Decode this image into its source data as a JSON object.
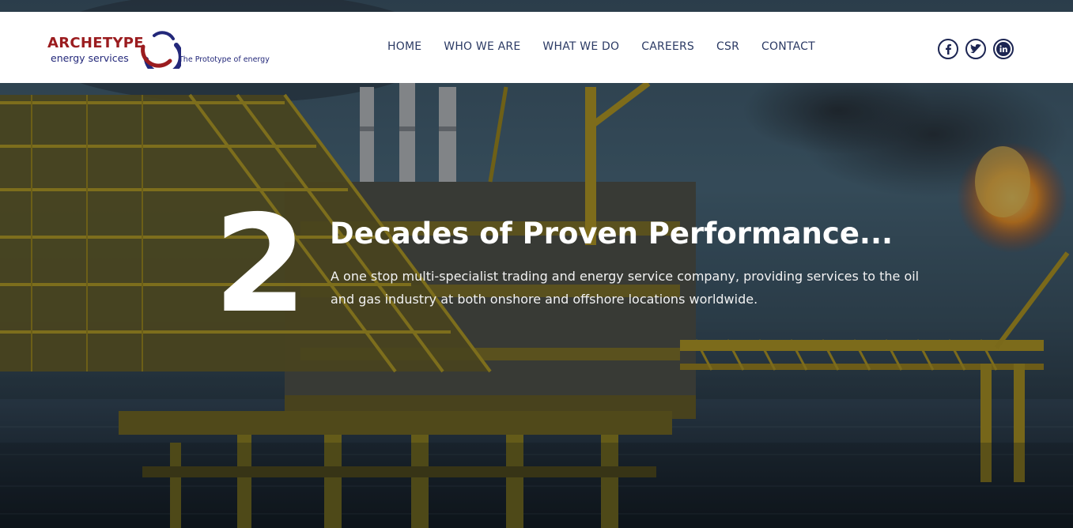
{
  "brand": {
    "name": "ARCHETYPE",
    "subtitle": "energy services",
    "tagline": "The Prototype of energy",
    "colors": {
      "red": "#9b1c1f",
      "navy": "#23287a"
    }
  },
  "nav": {
    "items": [
      {
        "label": "HOME"
      },
      {
        "label": "WHO WE ARE"
      },
      {
        "label": "WHAT WE DO"
      },
      {
        "label": "CAREERS"
      },
      {
        "label": "CSR"
      },
      {
        "label": "CONTACT"
      }
    ]
  },
  "social": {
    "items": [
      {
        "icon": "facebook-icon"
      },
      {
        "icon": "twitter-icon"
      },
      {
        "icon": "linkedin-icon"
      }
    ]
  },
  "hero": {
    "number": "2",
    "title": "Decades of Proven Performance...",
    "description": "A one stop multi-specialist trading and energy service company, providing services to the oil and gas industry at both onshore and offshore locations worldwide.",
    "background": "offshore-oil-platform-photo"
  }
}
